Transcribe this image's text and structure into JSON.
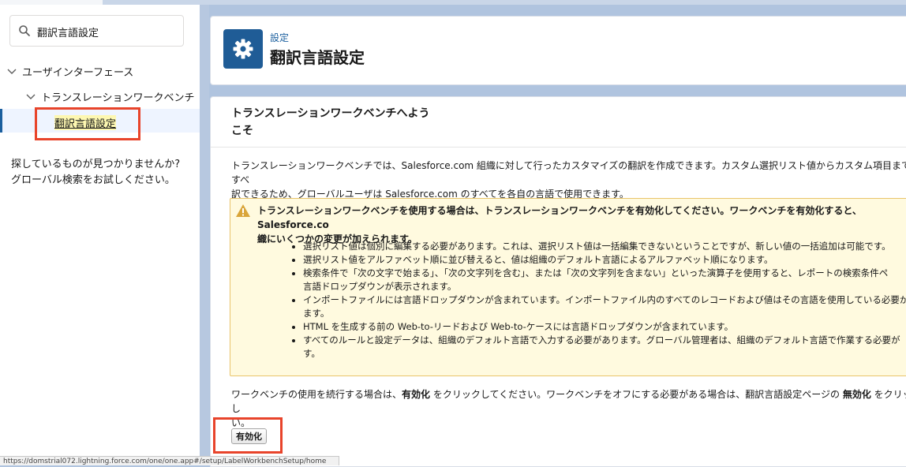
{
  "sidebar": {
    "search_value": "翻訳言語設定",
    "tree": {
      "level1": "ユーザインターフェース",
      "level2": "トランスレーションワークベンチ",
      "selected": "翻訳言語設定"
    },
    "not_found_line1": "探しているものが見つかりませんか?",
    "not_found_line2": "グローバル検索をお試しください。"
  },
  "header": {
    "subtitle": "設定",
    "title": "翻訳言語設定"
  },
  "main": {
    "title": "トランスレーションワークベンチへようこそ",
    "intro": "トランスレーションワークベンチでは、Salesforce.com 組織に対して行ったカスタマイズの翻訳を作成できます。カスタム選択リスト値からカスタム項目までのすべ\n訳できるため、グローバルユーザは Salesforce.com のすべてを各自の言語で使用できます。",
    "warning_title": "トランスレーションワークベンチを使用する場合は、トランスレーションワークベンチを有効化してください。ワークベンチを有効化すると、Salesforce.co\n織にいくつかの変更が加えられます。",
    "warning_items": [
      "選択リスト値は個別に編集する必要があります。これは、選択リスト値は一括編集できないということですが、新しい値の一括追加は可能です。",
      "選択リスト値をアルファベット順に並び替えると、値は組織のデフォルト言語によるアルファベット順になります。",
      "検索条件で「次の文字で始まる」、「次の文字列を含む」、または「次の文字列を含まない」といった演算子を使用すると、レポートの検索条件ペ\n言語ドロップダウンが表示されます。",
      "インポートファイルには言語ドロップダウンが含まれています。インポートファイル内のすべてのレコードおよび値はその言語を使用している必要が\nます。",
      "HTML を生成する前の Web-to-リードおよび Web-to-ケースには言語ドロップダウンが含まれています。",
      "すべてのルールと設定データは、組織のデフォルト言語で入力する必要があります。グローバル管理者は、組織のデフォルト言語で作業する必要が\nす。"
    ],
    "footer_part1": "ワークベンチの使用を続行する場合は、",
    "footer_bold1": "有効化",
    "footer_part2": " をクリックしてください。ワークベンチをオフにする必要がある場合は、翻訳言語設定ページの ",
    "footer_bold2": "無効化",
    "footer_part3": " をクリックし",
    "footer_part4": "い。",
    "enable_button": "有効化"
  },
  "statusbar": {
    "url": "https://domstrial072.lightning.force.com/one/one.app#/setup/LabelWorkbenchSetup/home"
  },
  "colors": {
    "accent": "#1f5c96",
    "highlight_box": "#e8442b",
    "warning_bg": "#fffadf"
  }
}
